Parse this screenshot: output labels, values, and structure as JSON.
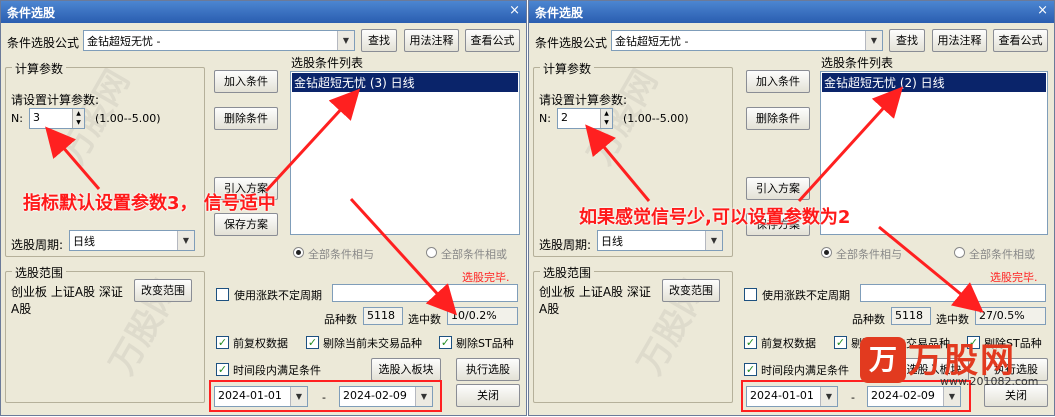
{
  "left": {
    "title": "条件选股",
    "close_glyph": "×",
    "formula_label": "条件选股公式",
    "formula_value": "金钻超短无忧  -",
    "find_btn": "查找",
    "usage_btn": "用法注释",
    "view_btn": "查看公式",
    "params_title": "计算参数",
    "params_hint": "请设置计算参数:",
    "n_label": "N:",
    "n_value": "3",
    "range_text": "(1.00--5.00)",
    "add_btn": "加入条件",
    "del_btn": "删除条件",
    "import_btn": "引入方案",
    "save_btn": "保存方案",
    "cond_list_title": "选股条件列表",
    "cond_item": "金钻超短无忧 (3) 日线",
    "all_and": "全部条件相与",
    "all_or": "全部条件相或",
    "period_label": "选股周期:",
    "period_value": "日线",
    "status": "选股完毕.",
    "range_title": "选股范围",
    "range_content": "创业板 上证A股 深证A股",
    "change_range_btn": "改变范围",
    "use_limit": "使用涨跌不定周期",
    "count_label": "品种数",
    "count_value": "5118",
    "selected_label": "选中数",
    "selected_value": "10/0.2%",
    "pre_adj": "前复权数据",
    "exclude_untraded": "剔除当前未交易品种",
    "exclude_st": "剔除ST品种",
    "time_cond": "时间段内满足条件",
    "to_board_btn": "选股入板块",
    "exec_btn": "执行选股",
    "date_from": "2024-01-01",
    "date_sep": "-",
    "date_to": "2024-02-09",
    "close_btn": "关闭",
    "callout": "指标默认设置参数3，  信号适中"
  },
  "right": {
    "title": "条件选股",
    "close_glyph": "×",
    "formula_label": "条件选股公式",
    "formula_value": "金钻超短无忧  -",
    "find_btn": "查找",
    "usage_btn": "用法注释",
    "view_btn": "查看公式",
    "params_title": "计算参数",
    "params_hint": "请设置计算参数:",
    "n_label": "N:",
    "n_value": "2",
    "range_text": "(1.00--5.00)",
    "add_btn": "加入条件",
    "del_btn": "删除条件",
    "import_btn": "引入方案",
    "save_btn": "保存方案",
    "cond_list_title": "选股条件列表",
    "cond_item": "金钻超短无忧 (2) 日线",
    "all_and": "全部条件相与",
    "all_or": "全部条件相或",
    "period_label": "选股周期:",
    "period_value": "日线",
    "status": "选股完毕.",
    "range_title": "选股范围",
    "range_content": "创业板 上证A股 深证A股",
    "change_range_btn": "改变范围",
    "use_limit": "使用涨跌不定周期",
    "count_label": "品种数",
    "count_value": "5118",
    "selected_label": "选中数",
    "selected_value": "27/0.5%",
    "pre_adj": "前复权数据",
    "exclude_untraded": "剔除当前未交易品种",
    "exclude_st": "剔除ST品种",
    "time_cond": "时间段内满足条件",
    "to_board_btn": "选股入板块",
    "exec_btn": "执行选股",
    "date_from": "2024-01-01",
    "date_sep": "-",
    "date_to": "2024-02-09",
    "close_btn": "关闭",
    "callout": "如果感觉信号少,可以设置参数为2",
    "logo_text": "万股网",
    "logo_sub": "www.201082.com"
  },
  "watermark": "万股网"
}
